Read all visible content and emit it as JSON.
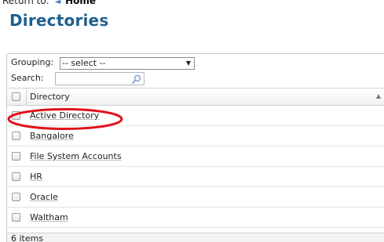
{
  "return_to": {
    "label": "Return to:",
    "link": "Home"
  },
  "page_title": "Directories",
  "toolbar": {
    "grouping_label": "Grouping:",
    "grouping_value": "-- select --",
    "search_label": "Search:",
    "search_value": ""
  },
  "table": {
    "column_header": "Directory",
    "rows": [
      {
        "label": "Active Directory",
        "highlighted": true
      },
      {
        "label": "Bangalore"
      },
      {
        "label": "File System Accounts"
      },
      {
        "label": "HR"
      },
      {
        "label": "Oracle"
      },
      {
        "label": "Waltham"
      }
    ]
  },
  "footer": {
    "count_text": "6 items"
  },
  "colors": {
    "title": "#1f5f8b",
    "highlight_ellipse": "#e0111b"
  }
}
